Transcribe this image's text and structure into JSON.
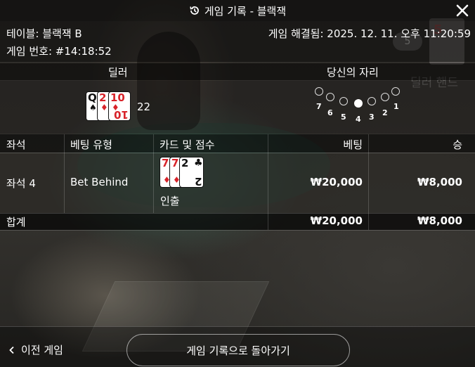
{
  "background": {
    "dealer_hand_label": "딜러 핸드",
    "badge": "5"
  },
  "header": {
    "title": "게임 기록 - 블랙잭"
  },
  "info": {
    "table_label": "테이블: 블랙잭 B",
    "game_number": "게임 번호: #14:18:52",
    "resolved": "게임 해결됨: 2025. 12. 11. 오후 11:20:59"
  },
  "dealer": {
    "label": "딜러",
    "cards": [
      {
        "rank": "Q",
        "suit": "♠",
        "color": "#111111"
      },
      {
        "rank": "2",
        "suit": "♦",
        "color": "#d8232a"
      },
      {
        "rank": "10",
        "suit": "♦",
        "color": "#d8232a"
      }
    ],
    "score": "22"
  },
  "seats": {
    "label": "당신의 자리",
    "numbers": [
      "7",
      "6",
      "5",
      "4",
      "3",
      "2",
      "1"
    ],
    "active": "4"
  },
  "table": {
    "headers": {
      "seat": "좌석",
      "bet_type": "베팅 유형",
      "cards_score": "카드 및 점수",
      "bet": "베팅",
      "win": "승"
    },
    "rows": [
      {
        "seat": "좌석 4",
        "bet_type": "Bet Behind",
        "cards": [
          {
            "rank": "7",
            "suit": "♦",
            "color": "#d8232a"
          },
          {
            "rank": "7",
            "suit": "♦",
            "color": "#d8232a"
          },
          {
            "rank": "2",
            "suit": "♣",
            "color": "#111111"
          }
        ],
        "result": "인출",
        "bet": "₩20,000",
        "win": "₩8,000"
      }
    ],
    "total": {
      "label": "합계",
      "bet": "₩20,000",
      "win": "₩8,000"
    }
  },
  "footer": {
    "prev_label": "이전 게임",
    "back_label": "게임 기록으로 돌아가기"
  }
}
